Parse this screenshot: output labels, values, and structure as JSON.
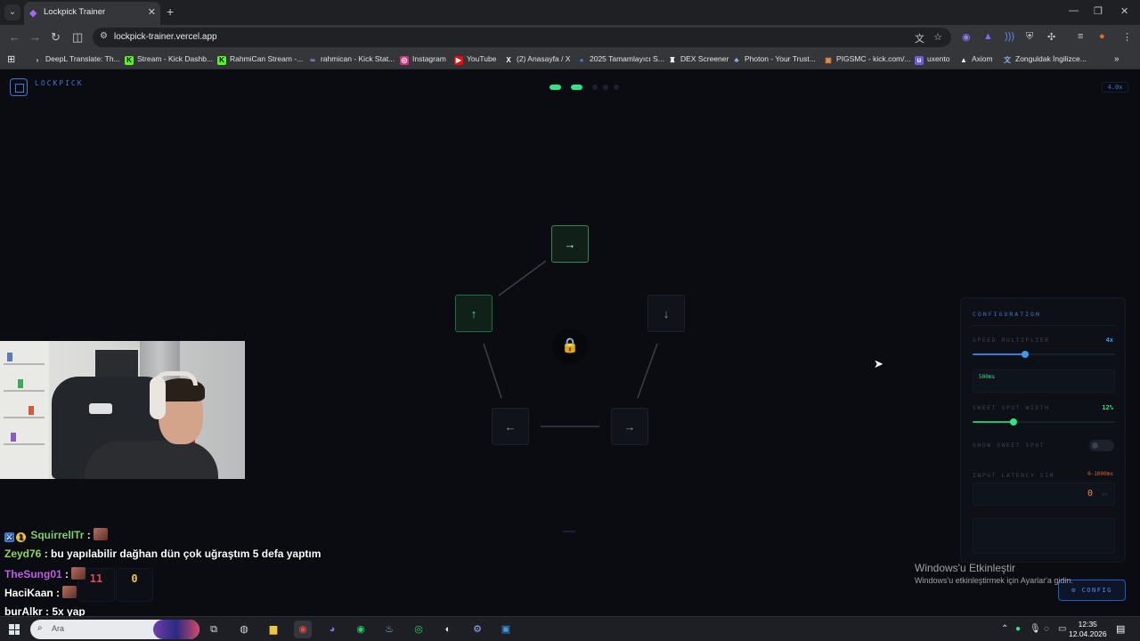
{
  "browser": {
    "tab_title": "Lockpick Trainer",
    "url": "lockpick-trainer.vercel.app",
    "bookmarks": [
      "DeepL Translate: Th...",
      "Stream - Kick Dashb...",
      "RahmiCan Stream -...",
      "rahmican - Kick Stat...",
      "Instagram",
      "YouTube",
      "(2) Anasayfa / X",
      "2025 Tamamlayıcı S...",
      "DEX Screener",
      "Photon - Your Trust...",
      "PIGSMC - kick.com/...",
      "uxento",
      "Axiom",
      "Zonguldak İngilizce..."
    ]
  },
  "app": {
    "logo_text": "LOCKPICK",
    "speed_badge": "4.0x",
    "progress": {
      "done": 2,
      "total": 5
    },
    "pins": [
      {
        "arrow": "→",
        "state": "active"
      },
      {
        "arrow": "↓",
        "state": "pending"
      },
      {
        "arrow": "→",
        "state": "pending"
      },
      {
        "arrow": "←",
        "state": "pending"
      },
      {
        "arrow": "↑",
        "state": "done"
      }
    ],
    "lock_icon": "lock-icon",
    "stats": [
      {
        "value": "11",
        "color": "#e0484f"
      },
      {
        "value": "0",
        "color": "#f2c53a"
      }
    ],
    "config_button": "⚙ CONFIG"
  },
  "config": {
    "title": "CONFIGURATION",
    "speed_label": "SPEED MULTIPLIER",
    "speed_value": "4x",
    "speed_fraction": 0.37,
    "speed_info_highlight": "500ms",
    "sweet_label": "SWEET SPOT WIDTH",
    "sweet_value": "12%",
    "sweet_fraction": 0.29,
    "show_sweet_label": "SHOW SWEET SPOT",
    "show_sweet_on": false,
    "latency_label": "INPUT LATENCY SIM",
    "latency_range": "0-1000ms",
    "latency_value": "0",
    "latency_unit": "ms"
  },
  "windows": {
    "watermark_title": "Windows'u Etkinleştir",
    "watermark_sub": "Windows'u etkinleştirmek için Ayarlar'a gidin.",
    "search_text": "Ara",
    "time": "12:35",
    "date": "12.04.2026"
  },
  "chat": [
    {
      "user": "SquirrelITr",
      "user_color": "#7dd36b",
      "message": ""
    },
    {
      "user": "Zeyd76",
      "user_color": "#8fe04f",
      "message": "bu yapılabilir dağhan dün çok uğraştım 5 defa yaptım"
    },
    {
      "user": "TheSung01",
      "user_color": "#c65cf0",
      "message": ""
    },
    {
      "user": "HaciKaan",
      "user_color": "#ffffff",
      "message": ""
    },
    {
      "user": "burAlkr",
      "user_color": "#ffffff",
      "message": "5x yap"
    }
  ]
}
